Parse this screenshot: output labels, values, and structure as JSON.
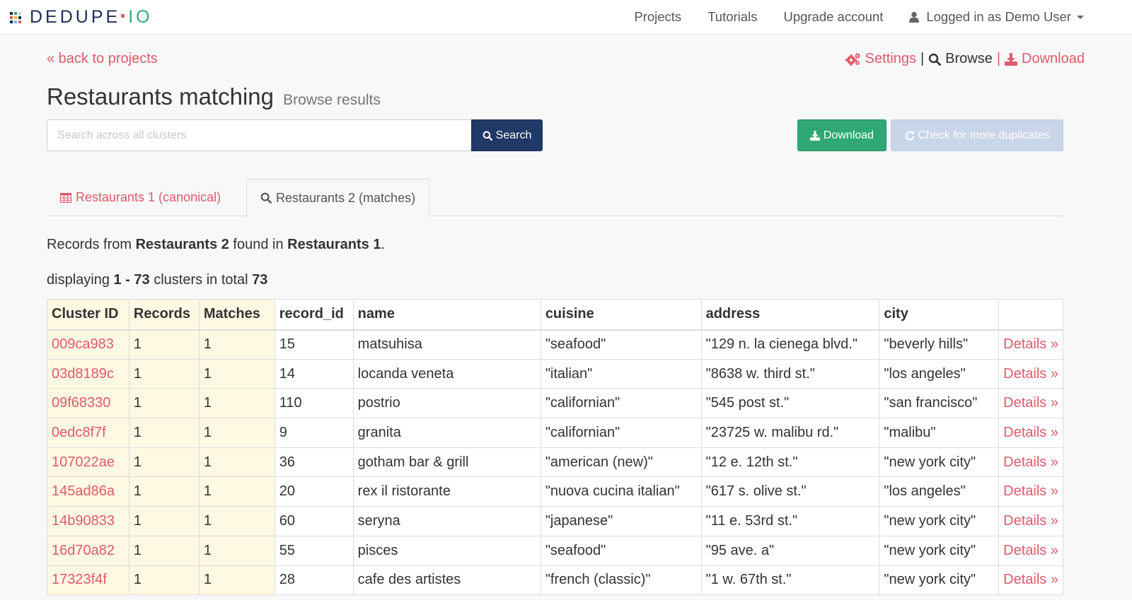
{
  "brand": {
    "name_part1": "DEDUPE",
    "name_part2": "IO",
    "grid_colors": [
      "#1d2b58",
      "#2fa876",
      "#c5cfe0",
      "#e05a6b",
      "#f2c12e",
      "#1d2b58",
      "#1d2b58",
      "#8fb5dd",
      "#e05a6b"
    ]
  },
  "nav": {
    "projects": "Projects",
    "tutorials": "Tutorials",
    "upgrade": "Upgrade account",
    "user": "Logged in as Demo User"
  },
  "back_link": "« back to projects",
  "top_actions": {
    "settings": "Settings",
    "sep1": "|",
    "browse": "Browse",
    "sep2": "|",
    "download": "Download"
  },
  "page": {
    "title": "Restaurants matching",
    "subtitle": "Browse results"
  },
  "search": {
    "placeholder": "Search across all clusters",
    "value": "",
    "button": "Search"
  },
  "buttons": {
    "download": "Download",
    "check_duplicates": "Check for more duplicates"
  },
  "tabs": [
    {
      "label": "Restaurants 1 (canonical)",
      "icon": "table-icon",
      "active": false
    },
    {
      "label": "Restaurants 2 (matches)",
      "icon": "search-icon",
      "active": true
    }
  ],
  "info": {
    "records_prefix": "Records from ",
    "records_source": "Restaurants 2",
    "records_mid": " found in ",
    "records_target": "Restaurants 1",
    "records_suffix": ".",
    "display_prefix": "displaying ",
    "display_range": "1 - 73",
    "display_mid": " clusters in total ",
    "display_total": "73"
  },
  "colors": {
    "accent": "#e05a6b",
    "primary": "#203966",
    "success": "#2fa876",
    "disabled": "#c9d5e8",
    "meta_column_bg": "#fdf9e3"
  },
  "table": {
    "headers": [
      "Cluster ID",
      "Records",
      "Matches",
      "record_id",
      "name",
      "cuisine",
      "address",
      "city",
      ""
    ],
    "details_label": "Details »",
    "rows": [
      {
        "cluster_id": "009ca983",
        "records": "1",
        "matches": "1",
        "record_id": "15",
        "name": "matsuhisa",
        "cuisine": "\"seafood\"",
        "address": "\"129 n. la cienega blvd.\"",
        "city": "\"beverly hills\""
      },
      {
        "cluster_id": "03d8189c",
        "records": "1",
        "matches": "1",
        "record_id": "14",
        "name": "locanda veneta",
        "cuisine": "\"italian\"",
        "address": "\"8638 w. third st.\"",
        "city": "\"los angeles\""
      },
      {
        "cluster_id": "09f68330",
        "records": "1",
        "matches": "1",
        "record_id": "110",
        "name": "postrio",
        "cuisine": "\"californian\"",
        "address": "\"545 post st.\"",
        "city": "\"san francisco\""
      },
      {
        "cluster_id": "0edc8f7f",
        "records": "1",
        "matches": "1",
        "record_id": "9",
        "name": "granita",
        "cuisine": "\"californian\"",
        "address": "\"23725 w. malibu rd.\"",
        "city": "\"malibu\""
      },
      {
        "cluster_id": "107022ae",
        "records": "1",
        "matches": "1",
        "record_id": "36",
        "name": "gotham bar & grill",
        "cuisine": "\"american (new)\"",
        "address": "\"12 e. 12th st.\"",
        "city": "\"new york city\""
      },
      {
        "cluster_id": "145ad86a",
        "records": "1",
        "matches": "1",
        "record_id": "20",
        "name": "rex il ristorante",
        "cuisine": "\"nuova cucina italian\"",
        "address": "\"617 s. olive st.\"",
        "city": "\"los angeles\""
      },
      {
        "cluster_id": "14b90833",
        "records": "1",
        "matches": "1",
        "record_id": "60",
        "name": "seryna",
        "cuisine": "\"japanese\"",
        "address": "\"11 e. 53rd st.\"",
        "city": "\"new york city\""
      },
      {
        "cluster_id": "16d70a82",
        "records": "1",
        "matches": "1",
        "record_id": "55",
        "name": "pisces",
        "cuisine": "\"seafood\"",
        "address": "\"95 ave. a\"",
        "city": "\"new york city\""
      },
      {
        "cluster_id": "17323f4f",
        "records": "1",
        "matches": "1",
        "record_id": "28",
        "name": "cafe des artistes",
        "cuisine": "\"french (classic)\"",
        "address": "\"1 w. 67th st.\"",
        "city": "\"new york city\""
      }
    ]
  }
}
